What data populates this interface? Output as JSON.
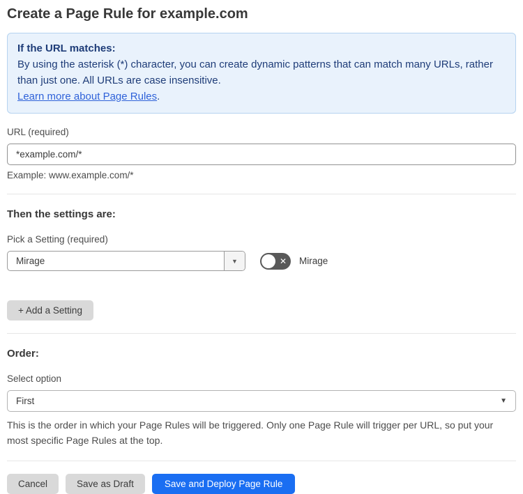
{
  "page": {
    "title": "Create a Page Rule for example.com"
  },
  "info_box": {
    "heading": "If the URL matches:",
    "body": "By using the asterisk (*) character, you can create dynamic patterns that can match many URLs, rather than just one. All URLs are case insensitive.",
    "link_label": "Learn more about Page Rules",
    "link_suffix": "."
  },
  "url_section": {
    "label": "URL (required)",
    "input_value": "*example.com/*",
    "helper": "Example: www.example.com/*"
  },
  "settings_section": {
    "heading": "Then the settings are:",
    "picker_label": "Pick a Setting (required)",
    "picker_value": "Mirage",
    "toggle_label": "Mirage",
    "toggle_state": "off",
    "add_setting_label": "+ Add a Setting"
  },
  "order_section": {
    "heading": "Order:",
    "label": "Select option",
    "select_value": "First",
    "helper": "This is the order in which your Page Rules will be triggered. Only one Page Rule will trigger per URL, so put your most specific Page Rules at the top."
  },
  "footer": {
    "cancel_label": "Cancel",
    "save_draft_label": "Save as Draft",
    "save_deploy_label": "Save and Deploy Page Rule"
  },
  "icons": {
    "dropdown_arrow": "▼",
    "toggle_x": "✕"
  },
  "colors": {
    "accent_blue": "#1a6ef2",
    "info_box_bg": "#e9f2fc",
    "info_box_border": "#b5d3f0",
    "info_text": "#1e3c78",
    "link_blue": "#2f62d9",
    "toggle_off_bg": "#595959",
    "button_gray": "#d9d9d9"
  }
}
